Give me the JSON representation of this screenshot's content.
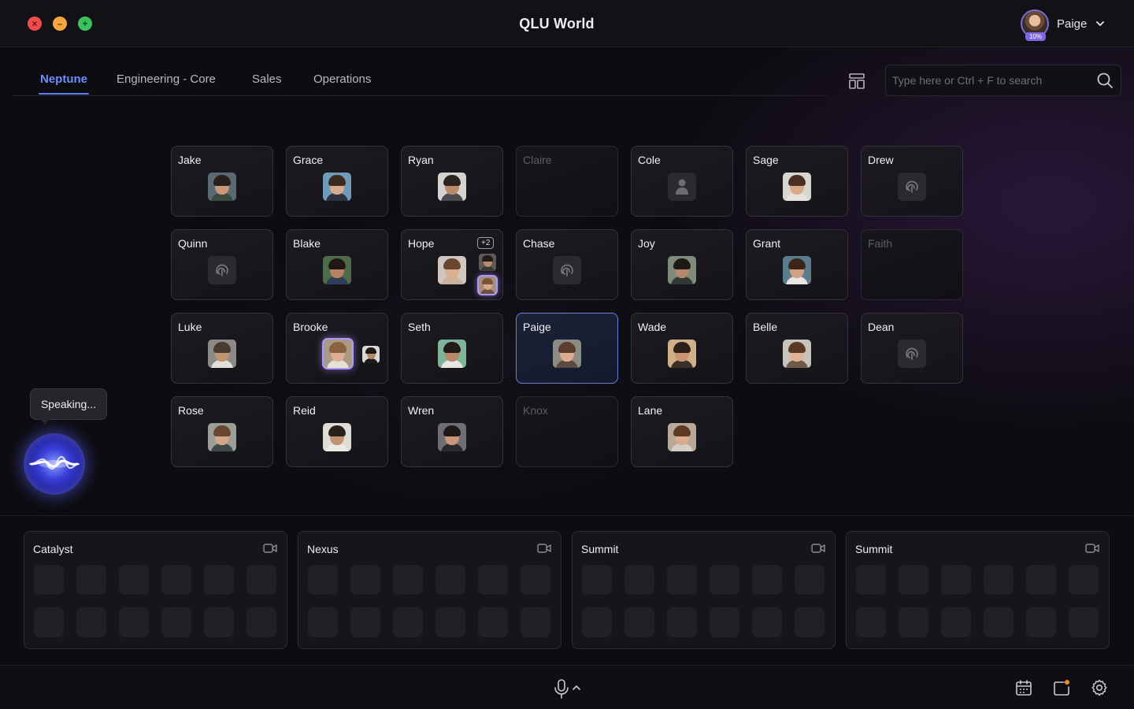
{
  "window": {
    "title": "QLU World",
    "controls": [
      "close",
      "minimize",
      "maximize"
    ]
  },
  "user": {
    "name": "Paige",
    "battery": "10%",
    "menu_icon": "chevron-down-icon"
  },
  "tabs": [
    {
      "label": "Neptune",
      "active": true
    },
    {
      "label": "Engineering - Core",
      "active": false
    },
    {
      "label": "Sales",
      "active": false
    },
    {
      "label": "Operations",
      "active": false
    }
  ],
  "search": {
    "placeholder": "Type here or Ctrl + F to search",
    "value": "",
    "icon": "search-icon"
  },
  "layout_toggle_icon": "layout-icon",
  "rooms": [
    {
      "name": "Jake",
      "state": "avatar"
    },
    {
      "name": "Grace",
      "state": "avatar"
    },
    {
      "name": "Ryan",
      "state": "avatar"
    },
    {
      "name": "Claire",
      "state": "empty"
    },
    {
      "name": "Cole",
      "state": "placeholder-person"
    },
    {
      "name": "Sage",
      "state": "avatar"
    },
    {
      "name": "Drew",
      "state": "away-icon"
    },
    {
      "name": "Quinn",
      "state": "away-icon"
    },
    {
      "name": "Blake",
      "state": "avatar"
    },
    {
      "name": "Hope",
      "state": "group",
      "extra_count": "+2"
    },
    {
      "name": "Chase",
      "state": "away-icon"
    },
    {
      "name": "Joy",
      "state": "avatar"
    },
    {
      "name": "Grant",
      "state": "avatar"
    },
    {
      "name": "Faith",
      "state": "empty"
    },
    {
      "name": "Luke",
      "state": "avatar"
    },
    {
      "name": "Brooke",
      "state": "visitor-speaking"
    },
    {
      "name": "Seth",
      "state": "avatar"
    },
    {
      "name": "Paige",
      "state": "avatar-current-user"
    },
    {
      "name": "Wade",
      "state": "avatar"
    },
    {
      "name": "Belle",
      "state": "avatar"
    },
    {
      "name": "Dean",
      "state": "away-icon"
    },
    {
      "name": "Rose",
      "state": "avatar"
    },
    {
      "name": "Reid",
      "state": "avatar"
    },
    {
      "name": "Wren",
      "state": "avatar"
    },
    {
      "name": "Knox",
      "state": "empty"
    },
    {
      "name": "Lane",
      "state": "avatar"
    }
  ],
  "speaking": {
    "label": "Speaking...",
    "indicator": "voice-wave-orb"
  },
  "meeting_rooms": [
    {
      "name": "Catalyst",
      "icon": "video-camera-icon",
      "seats": 12
    },
    {
      "name": "Nexus",
      "icon": "video-camera-icon",
      "seats": 12
    },
    {
      "name": "Summit",
      "icon": "video-camera-icon",
      "seats": 12
    },
    {
      "name": "Summit",
      "icon": "video-camera-icon",
      "seats": 12
    }
  ],
  "bottom_bar": {
    "center": [
      "microphone-icon",
      "chevron-up-icon"
    ],
    "right": [
      "calendar-icon",
      "notifications-icon",
      "settings-icon"
    ],
    "notification_dot_color": "#f08a2c"
  },
  "colors": {
    "accent": "#6f8cff",
    "active_room_border": "#6b7fd8",
    "speaking_glow": "#b196ff",
    "close": "#ef4c4c",
    "minimize": "#f2a541",
    "maximize": "#3dc15c"
  }
}
